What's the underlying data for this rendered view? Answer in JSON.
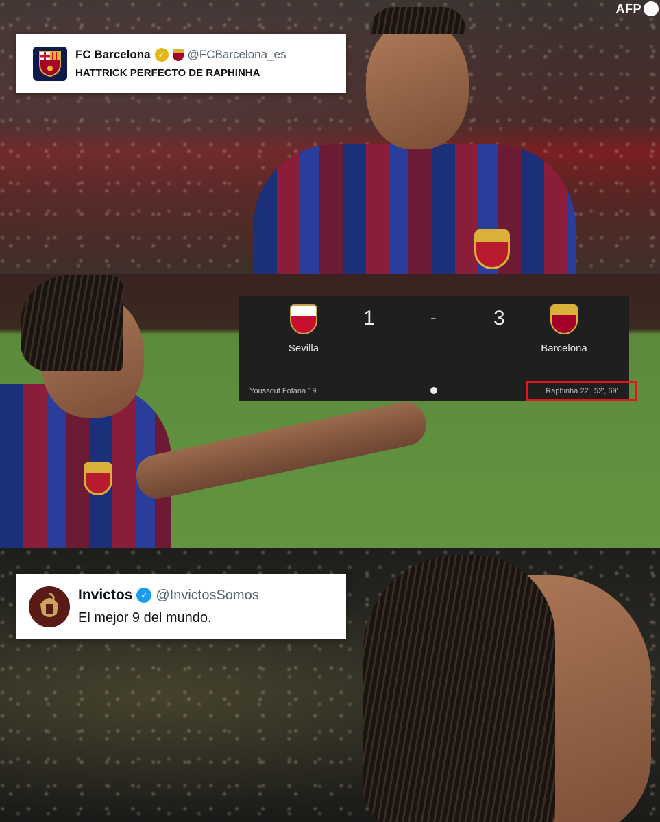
{
  "watermark": {
    "text": "AFP"
  },
  "tweets": [
    {
      "name": "FC Barcelona",
      "handle": "@FCBarcelona_es",
      "text": "HATTRICK PERFECTO DE RAPHINHA",
      "verified_color": "#e2b719"
    },
    {
      "name": "Invictos",
      "handle": "@InvictosSomos",
      "text": "El mejor 9 del mundo.",
      "verified_color": "#1d9bf0"
    }
  ],
  "scoreboard": {
    "home_team": "Sevilla",
    "away_team": "Barcelona",
    "home_score": "1",
    "separator": "-",
    "away_score": "3",
    "home_scorers": "Youssouf Fofana 19'",
    "away_scorers": "Raphinha 22', 52', 69'",
    "highlight_color": "#e4141b"
  },
  "icons": {
    "verified": "verified-badge-icon",
    "ball": "soccer-ball-icon"
  }
}
